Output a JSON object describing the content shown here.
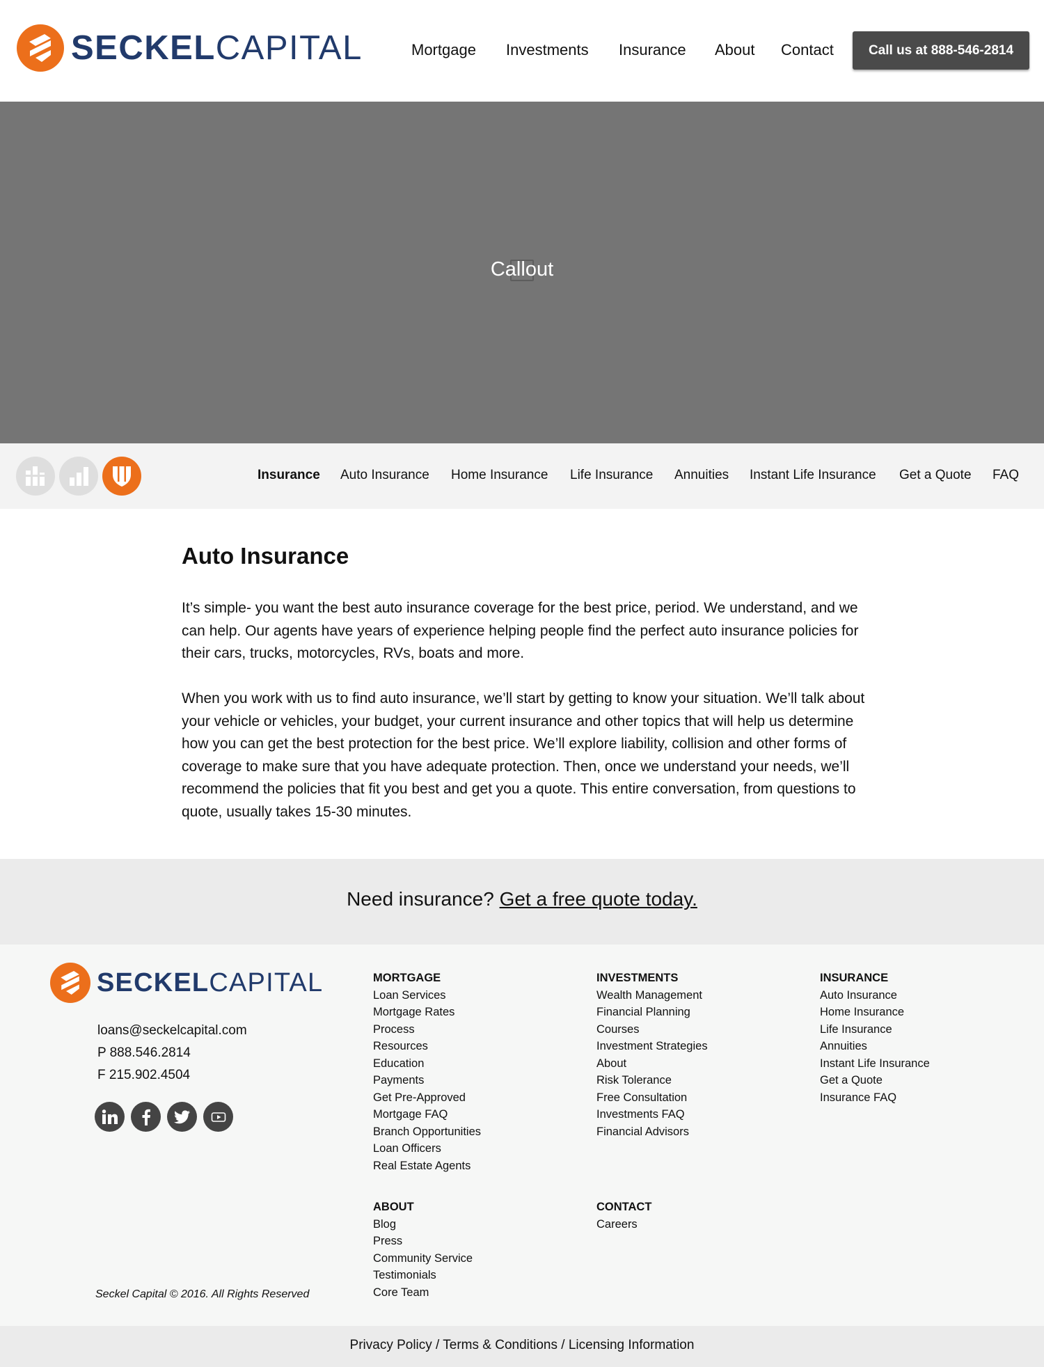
{
  "brand": {
    "name_bold": "SECKEL",
    "name_light": "CAPITAL",
    "orange": "#ec6f1b",
    "navy": "#213a6b"
  },
  "header": {
    "nav": [
      "Mortgage",
      "Investments",
      "Insurance",
      "About",
      "Contact"
    ],
    "call_label": "Call us at 888-546-2814"
  },
  "hero": {
    "text": "Callout"
  },
  "subnav": {
    "icons": [
      "investments-icon",
      "mortgage-icon",
      "insurance-shield-icon"
    ],
    "links": [
      "Insurance",
      "Auto Insurance",
      "Home Insurance",
      "Life Insurance",
      "Annuities",
      "Instant Life Insurance",
      "Get a Quote",
      "FAQ"
    ],
    "active": "Insurance"
  },
  "content": {
    "title": "Auto Insurance",
    "paragraphs": [
      "It’s simple- you want the best auto insurance coverage for the best price, period. We understand, and we can help. Our agents have years of experience helping people find the perfect auto insurance policies for their cars, trucks, motorcycles, RVs, boats and more.",
      "When you work with us to find auto insurance, we’ll start by getting to know your situation. We’ll talk about your vehicle or vehicles, your budget, your current insurance and other topics that will help us determine how you can get the best protection for the best price. We’ll explore liability, collision and other forms of coverage to make sure that you have adequate protection. Then, once we understand your needs, we’ll recommend the policies that fit you best and get you a quote. This entire conversation, from questions to quote, usually takes 15-30 minutes."
    ]
  },
  "cta": {
    "prefix": "Need insurance?",
    "link": "Get a free quote today."
  },
  "footer": {
    "email": "loans@seckelcapital.com",
    "phone": "P 888.546.2814",
    "fax": "F 215.902.4504",
    "social": [
      "linkedin-icon",
      "facebook-icon",
      "twitter-icon",
      "youtube-icon"
    ],
    "copyright": "Seckel Capital © 2016. All Rights Reserved",
    "columns": [
      {
        "heading": "MORTGAGE",
        "items": [
          "Loan Services",
          "Mortgage Rates",
          "Process",
          "Resources",
          "Education",
          "Payments",
          "Get Pre-Approved",
          "Mortgage FAQ",
          "Branch Opportunities",
          "Loan Officers",
          "Real Estate Agents"
        ]
      },
      {
        "heading": "INVESTMENTS",
        "items": [
          "Wealth Management",
          "Financial Planning",
          "Courses",
          "Investment Strategies",
          "About",
          "Risk Tolerance",
          "Free Consultation",
          "Investments FAQ",
          "Financial Advisors"
        ]
      },
      {
        "heading": "INSURANCE",
        "items": [
          "Auto Insurance",
          "Home Insurance",
          "Life Insurance",
          "Annuities",
          "Instant Life Insurance",
          "Get a Quote",
          "Insurance FAQ"
        ]
      },
      {
        "heading": "ABOUT",
        "items": [
          "Blog",
          "Press",
          "Community Service",
          "Testimonials",
          "Core Team"
        ]
      },
      {
        "heading": "CONTACT",
        "items": [
          "Careers"
        ]
      }
    ]
  },
  "bottom_bar": {
    "text": "Privacy Policy / Terms & Conditions / Licensing Information"
  }
}
